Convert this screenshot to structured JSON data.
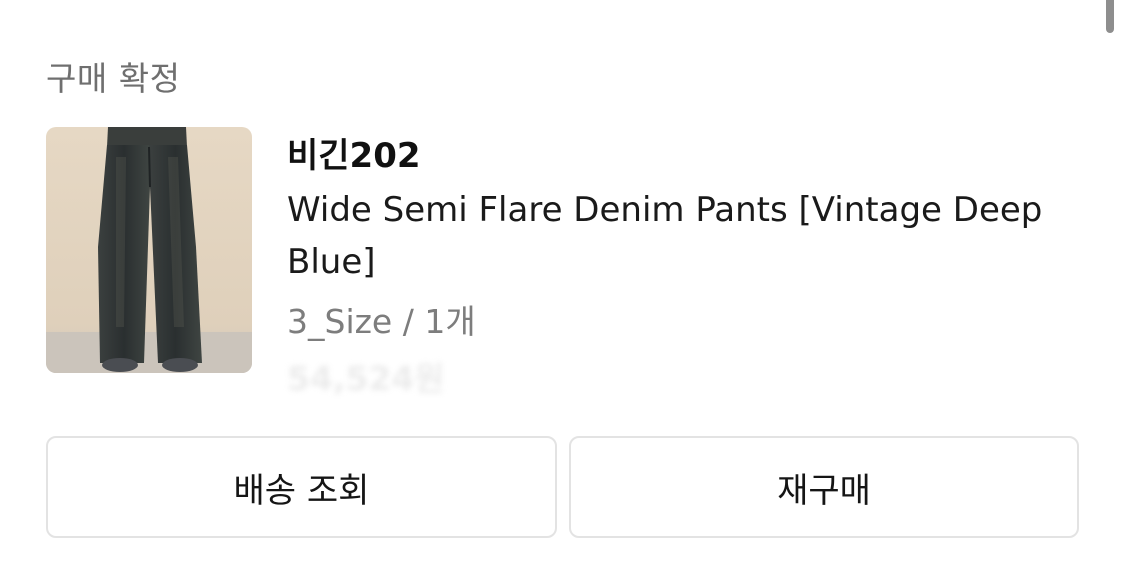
{
  "order": {
    "status": "구매 확정",
    "brand": "비긴202",
    "product_name": "Wide Semi Flare Denim Pants [Vintage Deep Blue]",
    "option": "3_Size / 1개",
    "price": "54,524원"
  },
  "actions": {
    "track_label": "배송 조회",
    "rebuy_label": "재구매"
  },
  "colors": {
    "status_text": "#6f6f6f",
    "option_text": "#7d7d7d",
    "button_border": "#e3e3e3",
    "denim": "#2f3334"
  },
  "icons": {
    "product_image": "denim-pants-photo"
  }
}
